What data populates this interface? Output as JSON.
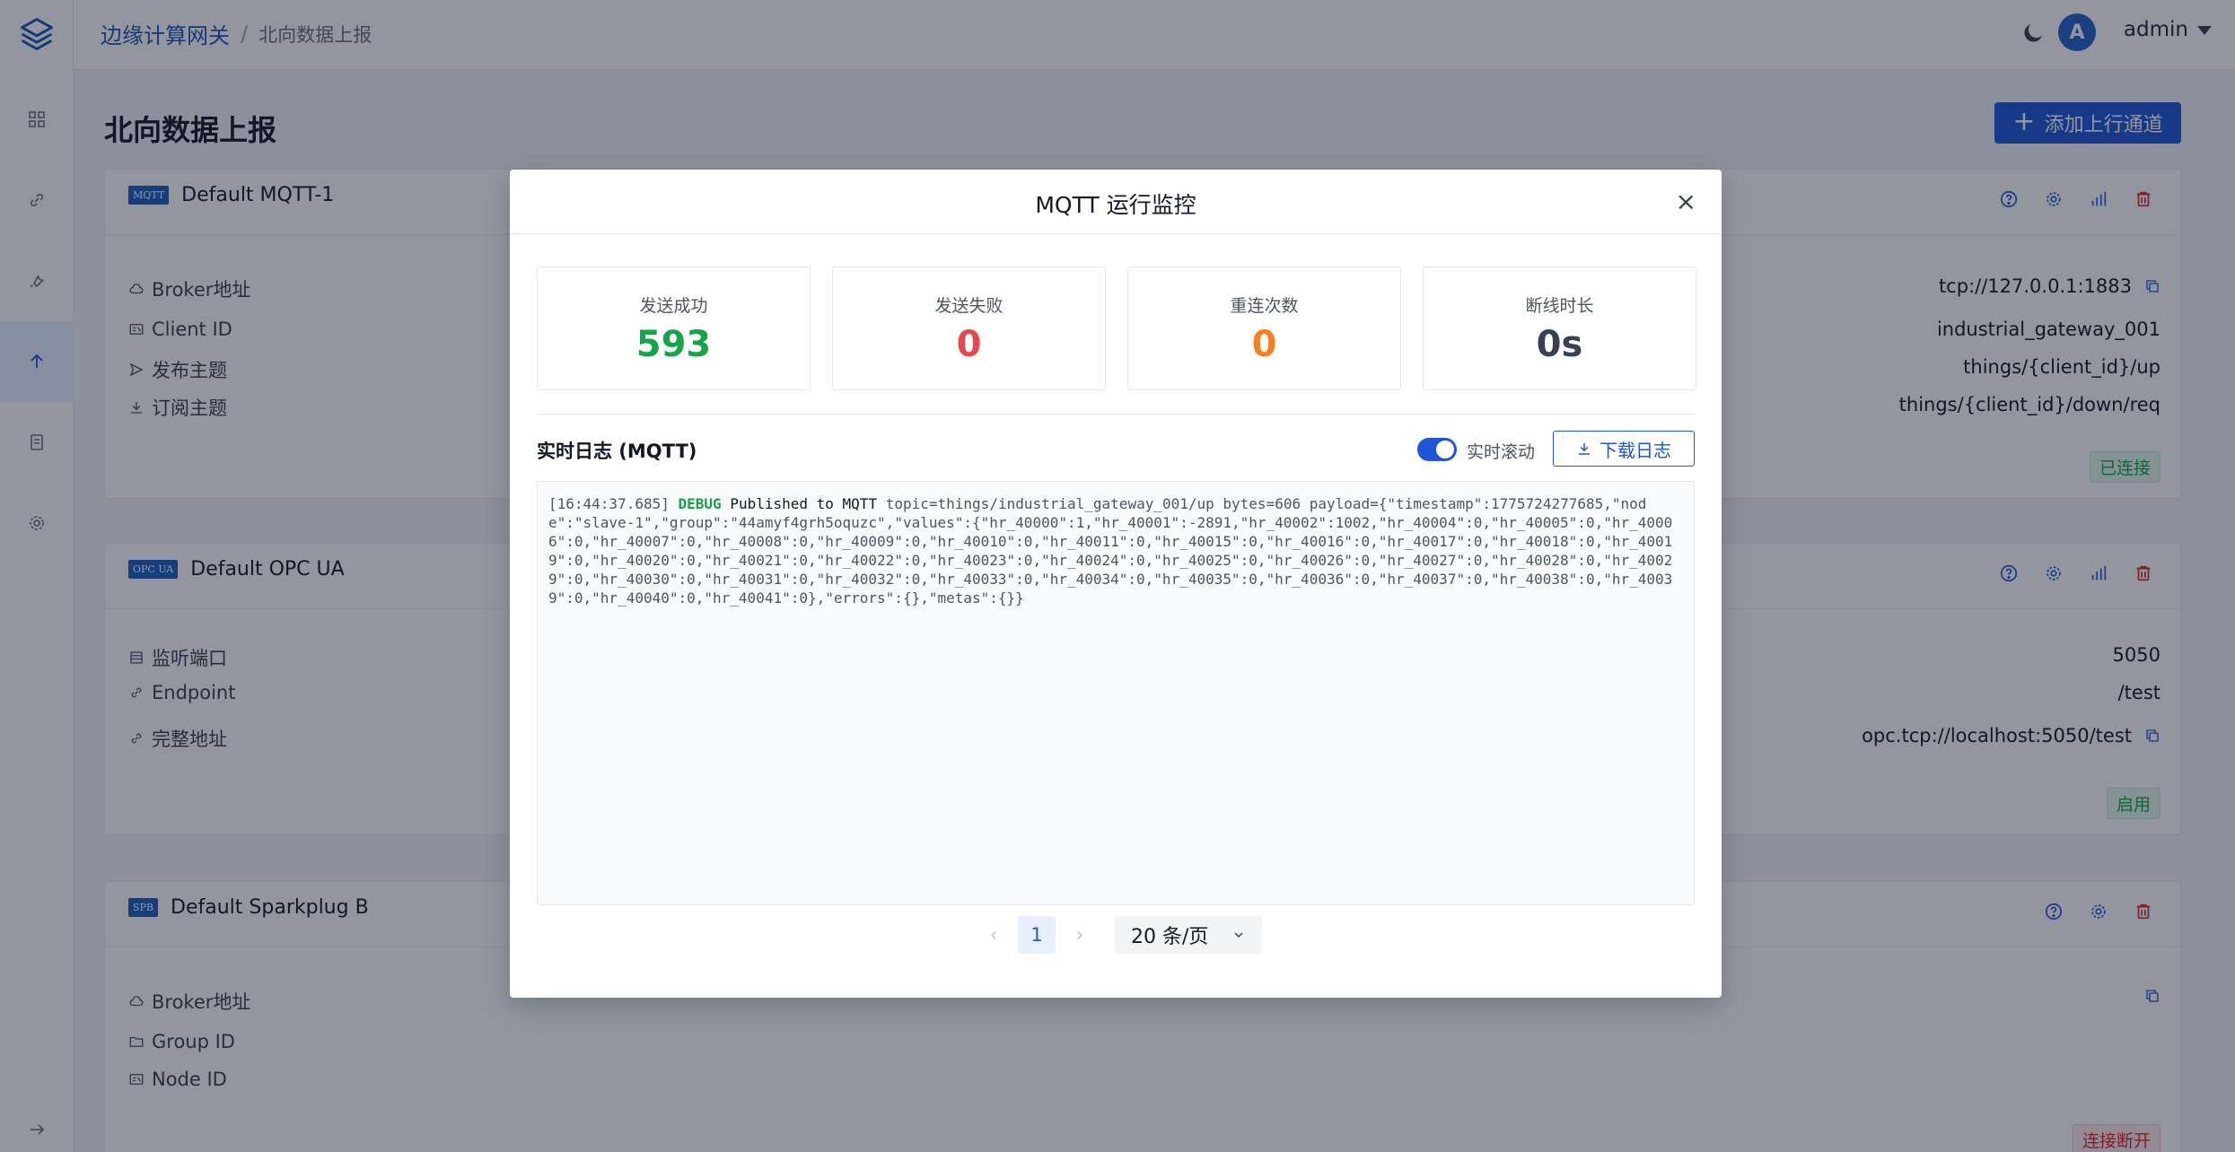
{
  "header": {
    "breadcrumb_root": "边缘计算网关",
    "breadcrumb_sep": "/",
    "breadcrumb_current": "北向数据上报",
    "avatar_letter": "A",
    "user_name": "admin"
  },
  "main": {
    "page_title": "北向数据上报",
    "add_button_label": "添加上行通道"
  },
  "cards": {
    "mqtt": {
      "badge": "MQTT",
      "title": "Default MQTT-1",
      "rows": [
        {
          "label": "Broker地址",
          "value": "tcp://127.0.0.1:1883"
        },
        {
          "label": "Client ID",
          "value": "industrial_gateway_001"
        },
        {
          "label": "发布主题",
          "value": "things/{client_id}/up"
        },
        {
          "label": "订阅主题",
          "value": "things/{client_id}/down/req"
        }
      ],
      "status": "已连接"
    },
    "opcua": {
      "badge": "OPC UA",
      "title": "Default OPC UA",
      "rows": [
        {
          "label": "监听端口",
          "value": "5050"
        },
        {
          "label": "Endpoint",
          "value": "/test"
        },
        {
          "label": "完整地址",
          "value": "opc.tcp://localhost:5050/test"
        }
      ],
      "status": "启用"
    },
    "sparkplug": {
      "badge": "SPB",
      "title": "Default Sparkplug B",
      "rows": [
        {
          "label": "Broker地址",
          "value": ""
        },
        {
          "label": "Group ID",
          "value": ""
        },
        {
          "label": "Node ID",
          "value": ""
        }
      ],
      "status": "连接断开"
    }
  },
  "modal": {
    "title": "MQTT 运行监控",
    "close": "×",
    "stats": [
      {
        "label": "发送成功",
        "value": "593",
        "color": "#16a34a"
      },
      {
        "label": "发送失败",
        "value": "0",
        "color": "#e5484d"
      },
      {
        "label": "重连次数",
        "value": "0",
        "color": "#f5821f"
      },
      {
        "label": "断线时长",
        "value": "0s",
        "color": "#374151"
      }
    ],
    "log_title": "实时日志 (MQTT)",
    "auto_scroll_label": "实时滚动",
    "download_label": "下载日志",
    "log": {
      "time": "[16:44:37.685]",
      "level": "DEBUG",
      "message": "Published to MQTT",
      "detail": "topic=things/industrial_gateway_001/up bytes=606 payload={\"timestamp\":1775724277685,\"node\":\"slave-1\",\"group\":\"44amyf4grh5oquzc\",\"values\":{\"hr_40000\":1,\"hr_40001\":-2891,\"hr_40002\":1002,\"hr_40004\":0,\"hr_40005\":0,\"hr_40006\":0,\"hr_40007\":0,\"hr_40008\":0,\"hr_40009\":0,\"hr_40010\":0,\"hr_40011\":0,\"hr_40015\":0,\"hr_40016\":0,\"hr_40017\":0,\"hr_40018\":0,\"hr_40019\":0,\"hr_40020\":0,\"hr_40021\":0,\"hr_40022\":0,\"hr_40023\":0,\"hr_40024\":0,\"hr_40025\":0,\"hr_40026\":0,\"hr_40027\":0,\"hr_40028\":0,\"hr_40029\":0,\"hr_40030\":0,\"hr_40031\":0,\"hr_40032\":0,\"hr_40033\":0,\"hr_40034\":0,\"hr_40035\":0,\"hr_40036\":0,\"hr_40037\":0,\"hr_40038\":0,\"hr_40039\":0,\"hr_40040\":0,\"hr_40041\":0},\"errors\":{},\"metas\":{}}"
    },
    "pagination": {
      "prev": "‹",
      "current_page": "1",
      "next": "›",
      "page_size": "20 条/页"
    }
  },
  "icons": {
    "logo": "layers-icon",
    "theme": "moon-icon",
    "sidebar": [
      "dashboard-icon",
      "link-icon",
      "wrench-icon",
      "upload-icon",
      "document-icon",
      "gear-icon",
      "expand-icon"
    ],
    "card_actions": [
      "help-icon",
      "gear-icon",
      "chart-icon",
      "trash-icon"
    ]
  },
  "colors": {
    "primary": "#1e56d6",
    "success": "#16a34a",
    "danger": "#dc2626"
  }
}
